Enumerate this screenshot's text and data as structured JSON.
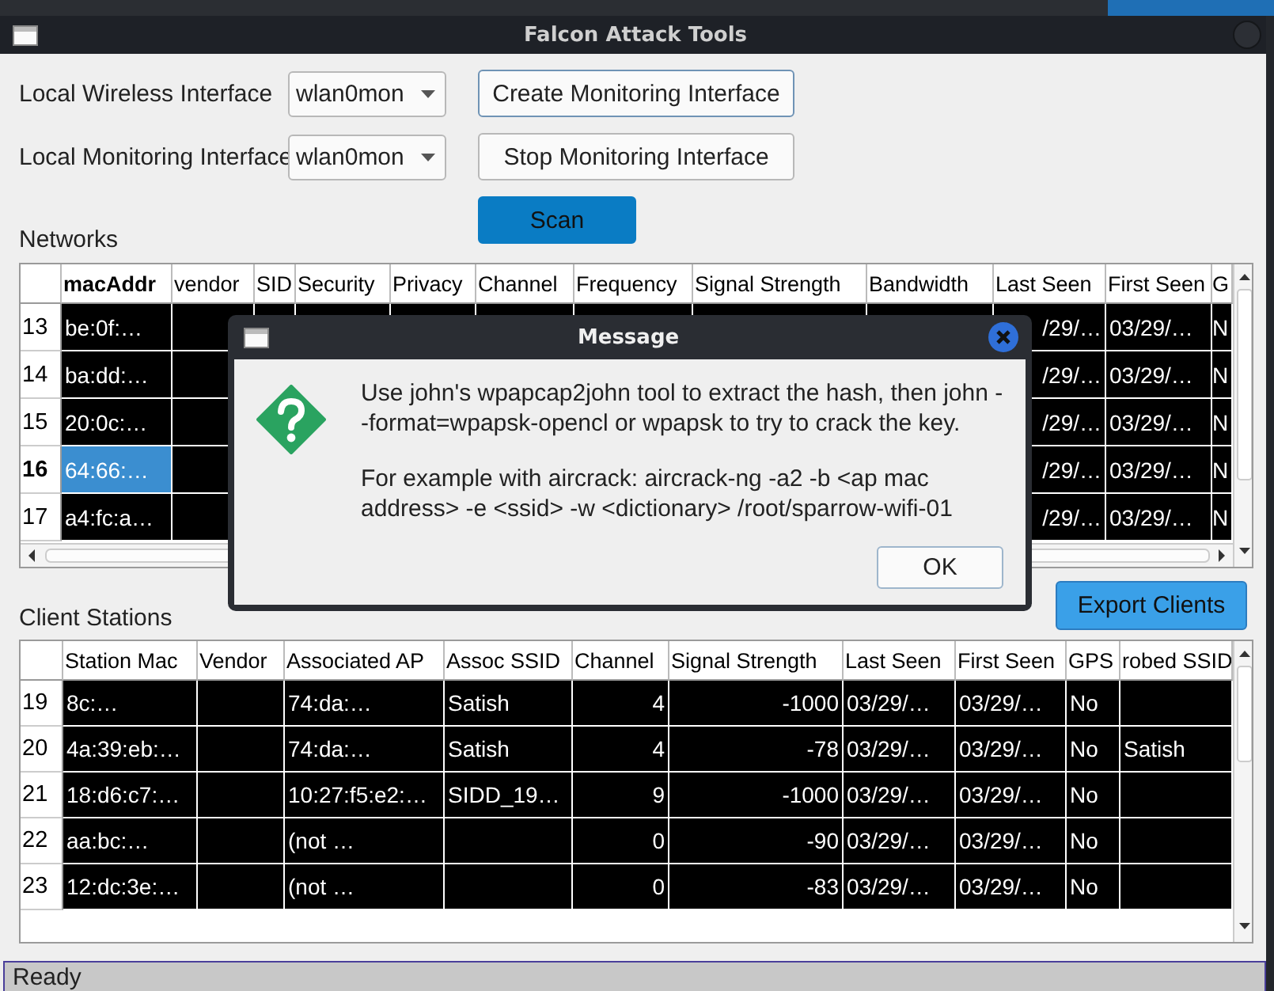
{
  "window": {
    "title": "Falcon Attack Tools"
  },
  "controls": {
    "wireless_label": "Local Wireless Interface",
    "wireless_value": "wlan0mon",
    "monitoring_label": "Local Monitoring Interface",
    "monitoring_value": "wlan0mon",
    "create_button": "Create Monitoring Interface",
    "stop_button": "Stop Monitoring Interface",
    "scan_button": "Scan"
  },
  "networks": {
    "label": "Networks",
    "columns": [
      "macAddr",
      "vendor",
      "SID",
      "Security",
      "Privacy",
      "Channel",
      "Frequency",
      "Signal Strength",
      "Bandwidth",
      "Last Seen",
      "First Seen",
      "G"
    ],
    "rows": [
      {
        "row": "13",
        "mac_addr": "be:0f:…",
        "last_seen": "/29/…",
        "first_seen": "03/29/…",
        "column_12": "N",
        "selected": false
      },
      {
        "row": "14",
        "mac_addr": "ba:dd:…",
        "last_seen": "/29/…",
        "first_seen": "03/29/…",
        "column_12": "N",
        "selected": false
      },
      {
        "row": "15",
        "mac_addr": "20:0c:…",
        "last_seen": "/29/…",
        "first_seen": "03/29/…",
        "column_12": "N",
        "selected": false
      },
      {
        "row": "16",
        "mac_addr": "64:66:…",
        "last_seen": "/29/…",
        "first_seen": "03/29/…",
        "column_12": "N",
        "selected": true
      },
      {
        "row": "17",
        "mac_addr": "a4:fc:a…",
        "last_seen": "/29/…",
        "first_seen": "03/29/…",
        "column_12": "N",
        "selected": false
      }
    ]
  },
  "clients": {
    "label": "Client Stations",
    "export_button": "Export Clients",
    "columns": [
      "Station Mac",
      "Vendor",
      "Associated AP",
      "Assoc SSID",
      "Channel",
      "Signal Strength",
      "Last Seen",
      "First Seen",
      "GPS",
      "robed SSID"
    ],
    "rows": [
      {
        "row": "19",
        "station_mac": "8c:…",
        "associated_ap": "74:da:…",
        "assoc_ssid": "Satish",
        "channel": "4",
        "signal_strength": "-1000",
        "last_seen": "03/29/…",
        "first_seen": "03/29/…",
        "gps": "No"
      },
      {
        "row": "20",
        "station_mac": "4a:39:eb:…",
        "associated_ap": "74:da:…",
        "assoc_ssid": "Satish",
        "channel": "4",
        "signal_strength": "-78",
        "last_seen": "03/29/…",
        "first_seen": "03/29/…",
        "gps": "No",
        "probed_ssid": "Satish"
      },
      {
        "row": "21",
        "station_mac": "18:d6:c7:…",
        "associated_ap": "10:27:f5:e2:…",
        "assoc_ssid": "SIDD_19…",
        "channel": "9",
        "signal_strength": "-1000",
        "last_seen": "03/29/…",
        "first_seen": "03/29/…",
        "gps": "No"
      },
      {
        "row": "22",
        "station_mac": "aa:bc:…",
        "associated_ap": "(not …",
        "channel": "0",
        "signal_strength": "-90",
        "last_seen": "03/29/…",
        "first_seen": "03/29/…",
        "gps": "No"
      },
      {
        "row": "23",
        "station_mac": "12:dc:3e:…",
        "associated_ap": "(not …",
        "channel": "0",
        "signal_strength": "-83",
        "last_seen": "03/29/…",
        "first_seen": "03/29/…",
        "gps": "No"
      }
    ]
  },
  "dialog": {
    "title": "Message",
    "paragraphs": [
      "Use john's wpapcap2john tool to extract the hash, then john --format=wpapsk-opencl or wpapsk to try to crack the key.",
      "For example with aircrack: aircrack-ng -a2 -b <ap mac address> -e <ssid> -w <dictionary> /root/sparrow-wifi-01"
    ],
    "ok_button": "OK"
  },
  "status_bar": "Ready"
}
